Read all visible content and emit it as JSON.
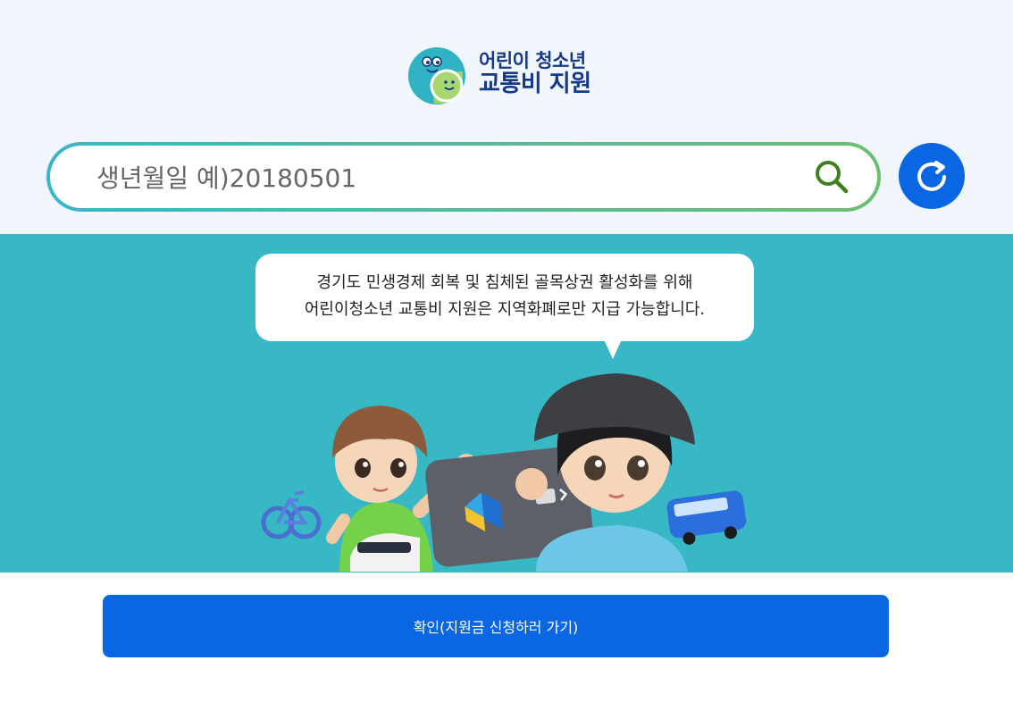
{
  "header": {
    "logo_line1": "어린이 청소년",
    "logo_line2": "교통비 지원"
  },
  "search": {
    "placeholder": "생년월일 예)20180501",
    "value": "",
    "search_icon": "search-icon",
    "refresh_icon": "refresh-icon"
  },
  "notice": {
    "line1": "경기도 민생경제 회복 및 침체된 골목상권 활성화를 위해",
    "line2": "어린이청소년 교통비 지원은 지역화폐로만 지급 가능합니다."
  },
  "actions": {
    "confirm_label": "확인(지원금 신청하러 가기)"
  },
  "colors": {
    "brand_blue": "#0b66e4",
    "hero_teal": "#38b7c5",
    "logo_navy": "#163a86",
    "search_gradient_start": "#3bb6c9",
    "search_gradient_end": "#6bbf6e",
    "search_icon_green": "#3f7f1f"
  }
}
